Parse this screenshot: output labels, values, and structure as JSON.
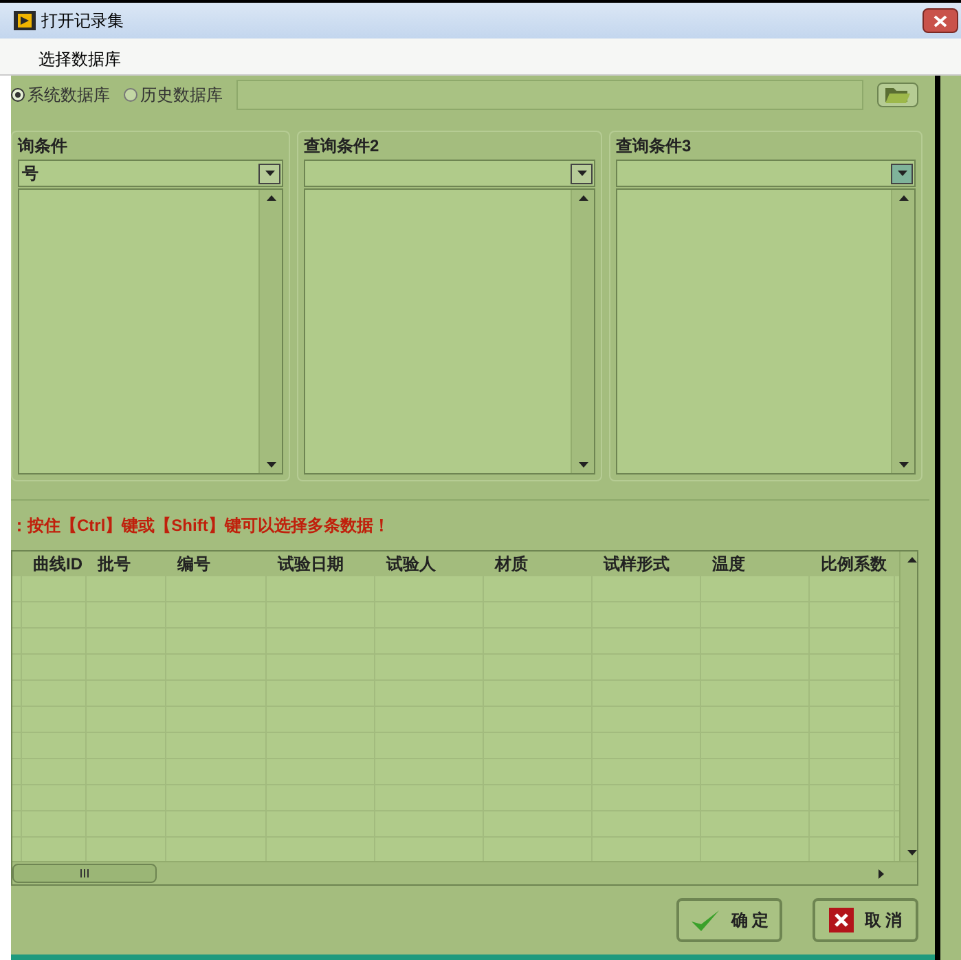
{
  "window": {
    "title": "打开记录集"
  },
  "database": {
    "label": "选择数据库",
    "options": [
      {
        "label": "系统数据库",
        "selected": true
      },
      {
        "label": "历史数据库",
        "selected": false
      }
    ]
  },
  "conditions": [
    {
      "title": "询条件",
      "value": "号"
    },
    {
      "title": "查询条件2"
    },
    {
      "title": "查询条件3"
    }
  ],
  "hint": "：按住【Ctrl】键或【Shift】键可以选择多条数据！",
  "table": {
    "columns": [
      "",
      "曲线ID",
      "批号",
      "编号",
      "试验日期",
      "试验人",
      "材质",
      "试样形式",
      "温度",
      "比例系数"
    ]
  },
  "buttons": [
    {
      "kind": "ok",
      "label": "确 定"
    },
    {
      "kind": "cancel",
      "label": "取 消"
    }
  ]
}
